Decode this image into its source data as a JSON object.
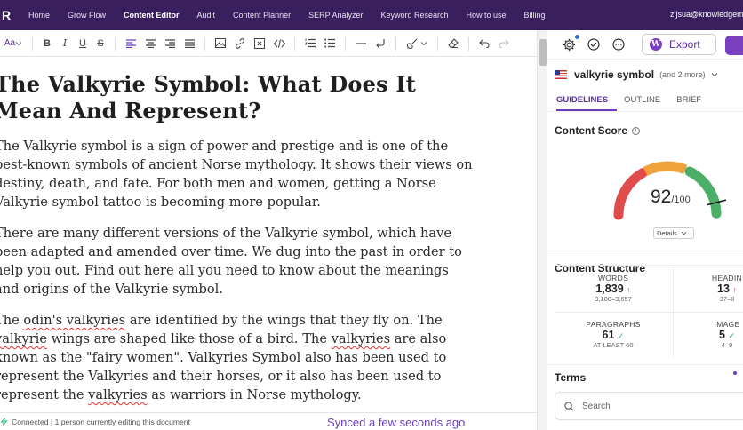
{
  "nav": {
    "logo": "R",
    "items": [
      "Home",
      "Grow Flow",
      "Content Editor",
      "Audit",
      "Content Planner",
      "SERP Analyzer",
      "Keyword Research",
      "How to use",
      "Billing"
    ],
    "active": "Content Editor",
    "user": "zijsua@knowledgem"
  },
  "toolbar": {
    "font_size_label": "Aa",
    "buttons": [
      "B",
      "I",
      "U",
      "S"
    ]
  },
  "document": {
    "title": "The Valkyrie Symbol: What Does It Mean And Represent?",
    "p1": "The Valkyrie symbol is a sign of power and prestige and is one of the best-known symbols of ancient Norse mythology. It shows their views on destiny, death, and fate. For both men and women, getting a Norse Valkyrie symbol tattoo is becoming more popular.",
    "p2": "There are many different versions of the Valkyrie symbol, which have been adapted and amended over time. We dug into the past in order to help you out. Find out here all you need to know about the meanings and origins of the Valkyrie symbol.",
    "p3": {
      "a": "The ",
      "b": "odin's valkyries",
      "c": " are identified by the wings that they fly on. The ",
      "d": "valkyrie",
      "e": " wings are shaped like those of a bird. The ",
      "f": "valkyries",
      "g": " are also known as the \"fairy women\". Valkyries Symbol also has been used to represent the Valkyries and their horses, or it also has been used to represent the ",
      "h": "valkyries",
      "i": " as warriors in Norse mythology."
    }
  },
  "status": {
    "connection": "Connected | 1 person currently editing this document",
    "synced": "Synced a few seconds ago"
  },
  "panel": {
    "export_label": "Export",
    "keyword": "valkyrie symbol",
    "keyword_more": "(and 2 more)",
    "tabs": [
      "GUIDELINES",
      "OUTLINE",
      "BRIEF"
    ],
    "active_tab": "GUIDELINES",
    "content_score_title": "Content Score",
    "score": "92",
    "score_max": "/100",
    "score_value": 92,
    "details_label": "Details",
    "content_structure_title": "Content Structure",
    "structure": {
      "words": {
        "label": "WORDS",
        "value": "1,839",
        "range": "3,180–3,657",
        "status": "up"
      },
      "headings": {
        "label": "HEADIN",
        "value": "13",
        "range": "37–8",
        "status": "up"
      },
      "paragraphs": {
        "label": "PARAGRAPHS",
        "value": "61",
        "range": "AT LEAST 60",
        "status": "ok"
      },
      "images": {
        "label": "IMAGE",
        "value": "5",
        "range": "4–9",
        "status": "ok"
      }
    },
    "terms_title": "Terms",
    "search_placeholder": "Search"
  },
  "colors": {
    "nav_bg": "#3a1f5e",
    "accent": "#6b3fbf",
    "gauge_red": "#e04b4b",
    "gauge_orange": "#f0a23a",
    "gauge_green": "#4caf68"
  }
}
